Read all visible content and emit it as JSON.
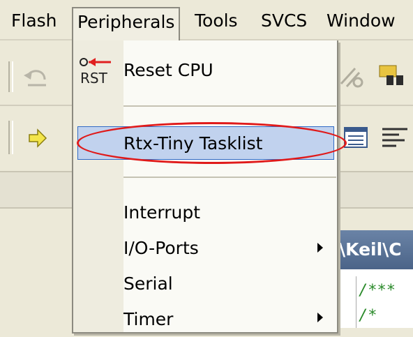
{
  "menubar": {
    "items": [
      {
        "label": "Flash"
      },
      {
        "label": "Peripherals"
      },
      {
        "label": "Tools"
      },
      {
        "label": "SVCS"
      },
      {
        "label": "Window"
      }
    ],
    "active_index": 1
  },
  "dropdown": {
    "reset_cpu_icon_text": "RST",
    "items": [
      {
        "label": "Reset CPU",
        "icon": "reset-cpu-icon"
      },
      {
        "label": "Rtx-Tiny Tasklist",
        "highlighted": true
      },
      {
        "label": "Interrupt"
      },
      {
        "label": "I/O-Ports",
        "submenu": true
      },
      {
        "label": "Serial"
      },
      {
        "label": "Timer",
        "submenu": true
      }
    ]
  },
  "editor": {
    "title_fragment": "\\Keil\\C",
    "lines": [
      "/***",
      "/*"
    ]
  },
  "colors": {
    "menu_bg": "#ece9d8",
    "highlight": "#c1d2ee",
    "annotation_ellipse": "#e01a1a",
    "title_bar": "#4b6488",
    "comment": "#2a8a2a"
  }
}
